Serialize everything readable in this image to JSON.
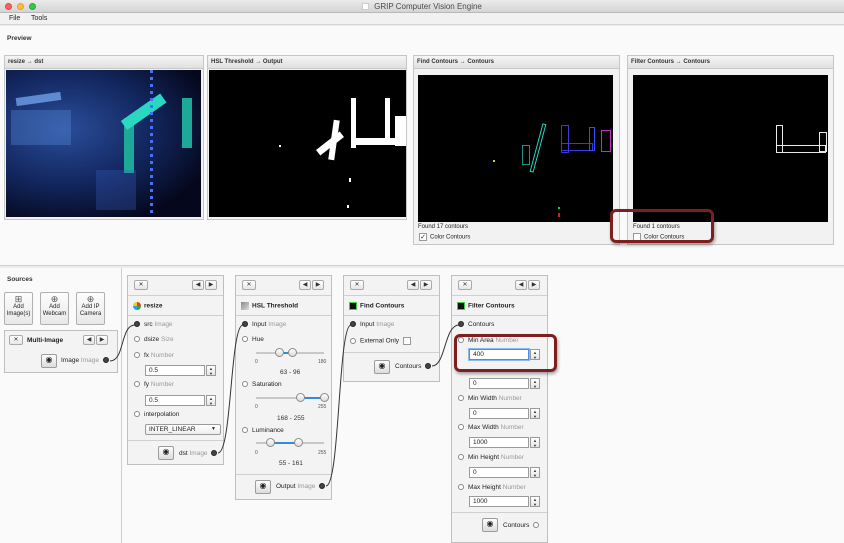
{
  "window": {
    "title": "GRIP Computer Vision Engine"
  },
  "menu": {
    "items": [
      "File",
      "Tools"
    ]
  },
  "preview": {
    "label": "Preview",
    "tiles": [
      {
        "title": "resize → dst"
      },
      {
        "title": "HSL Threshold → Output"
      },
      {
        "title": "Find Contours → Contours",
        "found": "Found 17 contours",
        "color_label": "Color Contours",
        "color_checked": true
      },
      {
        "title": "Filter Contours → Contours",
        "found": "Found 1 contours",
        "color_label": "Color Contours",
        "color_checked": false
      }
    ]
  },
  "sources": {
    "label": "Sources",
    "buttons": [
      {
        "label": "Add Image(s)",
        "icon": "add-image-icon"
      },
      {
        "label": "Add Webcam",
        "icon": "add-webcam-icon"
      },
      {
        "label": "Add IP Camera",
        "icon": "add-ip-camera-icon"
      }
    ],
    "multi_image": {
      "title": "Multi-Image",
      "output_label": "Image",
      "output_type": "Image"
    }
  },
  "steps": {
    "resize": {
      "title": "resize",
      "inputs": {
        "src": {
          "label": "src",
          "type": "Image"
        },
        "dsize": {
          "label": "dsize",
          "type": "Size"
        },
        "fx": {
          "label": "fx",
          "type": "Number",
          "value": "0.5"
        },
        "fy": {
          "label": "fy",
          "type": "Number",
          "value": "0.5"
        },
        "interpolation": {
          "label": "interpolation",
          "value": "INTER_LINEAR"
        }
      },
      "output": {
        "label": "dst",
        "type": "Image"
      }
    },
    "hsl": {
      "title": "HSL Threshold",
      "input": {
        "label": "Input",
        "type": "Image"
      },
      "hue": {
        "label": "Hue",
        "min": "0",
        "max": "180",
        "range": "63 - 96",
        "low": 63,
        "high": 96,
        "scale": 180
      },
      "saturation": {
        "label": "Saturation",
        "min": "0",
        "max": "255",
        "range": "168 - 255",
        "low": 168,
        "high": 255,
        "scale": 255
      },
      "luminance": {
        "label": "Luminance",
        "min": "0",
        "max": "255",
        "range": "55 - 161",
        "low": 55,
        "high": 161,
        "scale": 255
      },
      "output": {
        "label": "Output",
        "type": "Image"
      }
    },
    "find": {
      "title": "Find Contours",
      "input": {
        "label": "Input",
        "type": "Image"
      },
      "external": {
        "label": "External Only"
      },
      "output": {
        "label": "Contours"
      }
    },
    "filter": {
      "title": "Filter Contours",
      "input": {
        "label": "Contours"
      },
      "min_area": {
        "label": "Min Area",
        "type": "Number",
        "value": "400"
      },
      "min_perimeter": {
        "value": "0"
      },
      "min_width": {
        "label": "Min Width",
        "type": "Number",
        "value": "0"
      },
      "max_width": {
        "label": "Max Width",
        "type": "Number",
        "value": "1000"
      },
      "min_height": {
        "label": "Min Height",
        "type": "Number",
        "value": "0"
      },
      "max_height": {
        "label": "Max Height",
        "type": "Number",
        "value": "1000"
      },
      "output": {
        "label": "Contours"
      }
    }
  },
  "colors": {
    "accent": "#2f8de0",
    "highlight": "#7d1f1f",
    "cyan_target": "#27d6c4"
  }
}
